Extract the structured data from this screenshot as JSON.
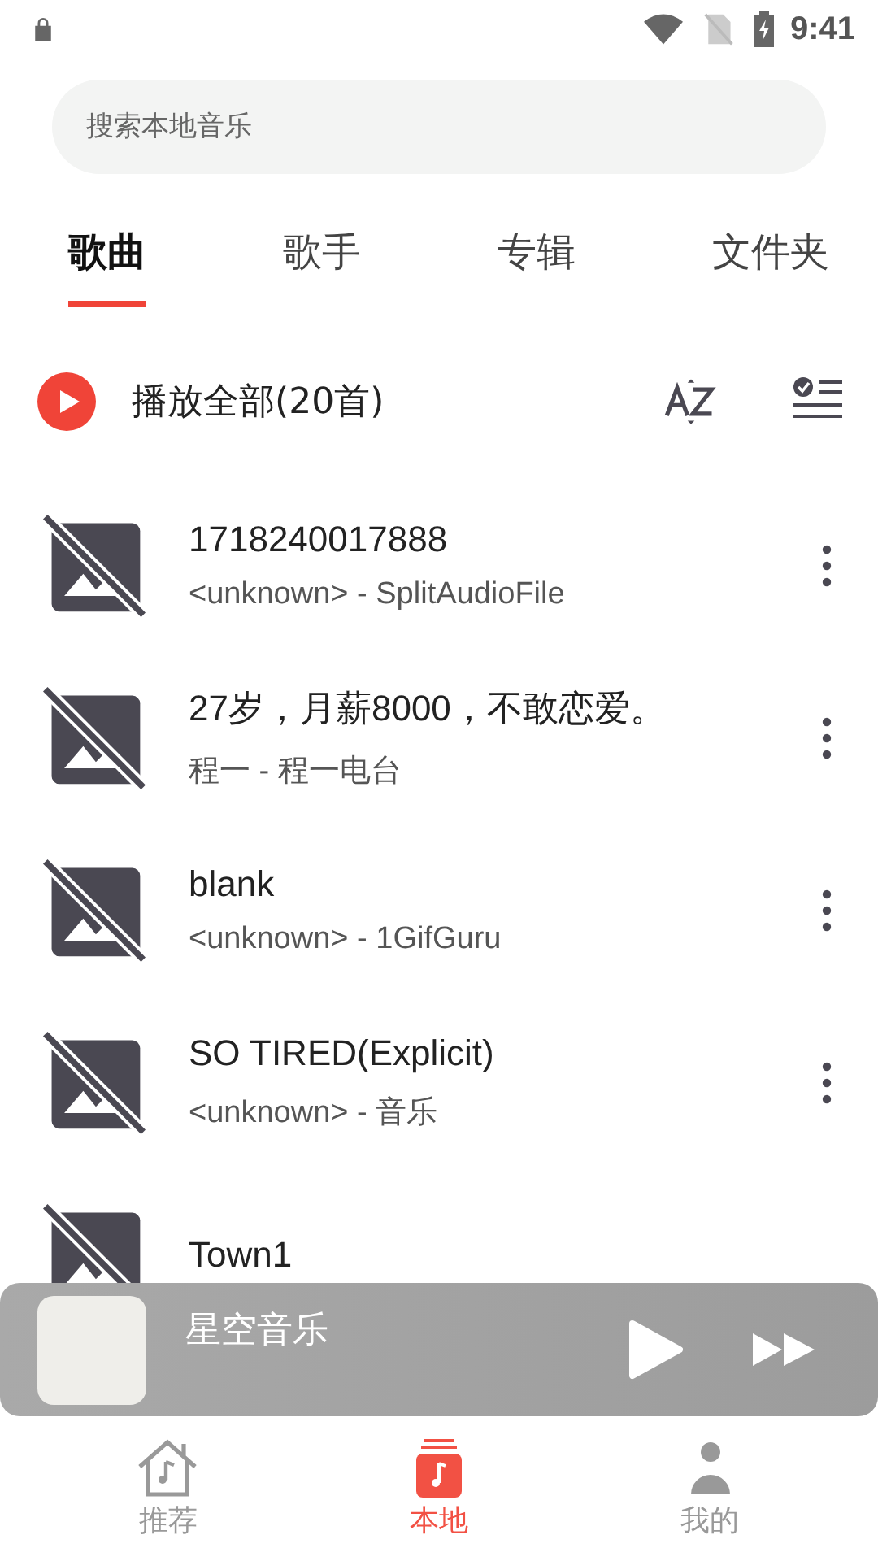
{
  "status_bar": {
    "time": "9:41"
  },
  "search": {
    "placeholder": "搜索本地音乐"
  },
  "tabs": [
    {
      "label": "歌曲",
      "selected": true
    },
    {
      "label": "歌手",
      "selected": false
    },
    {
      "label": "专辑",
      "selected": false
    },
    {
      "label": "文件夹",
      "selected": false
    }
  ],
  "play_all": {
    "label": "播放全部(20首)"
  },
  "songs": [
    {
      "title": "1718240017888",
      "subtitle": "<unknown> - SplitAudioFile"
    },
    {
      "title": "27岁，月薪8000，不敢恋爱。",
      "subtitle": "程一 - 程一电台"
    },
    {
      "title": "blank",
      "subtitle": "<unknown> - 1GifGuru"
    },
    {
      "title": "SO TIRED(Explicit)",
      "subtitle": "<unknown> - 音乐"
    },
    {
      "title": "Town1"
    }
  ],
  "mini_player": {
    "title": "星空音乐"
  },
  "bottom_nav": [
    {
      "label": "推荐",
      "kind": "home",
      "selected": false
    },
    {
      "label": "本地",
      "kind": "local",
      "selected": true
    },
    {
      "label": "我的",
      "kind": "profile",
      "selected": false
    }
  ]
}
